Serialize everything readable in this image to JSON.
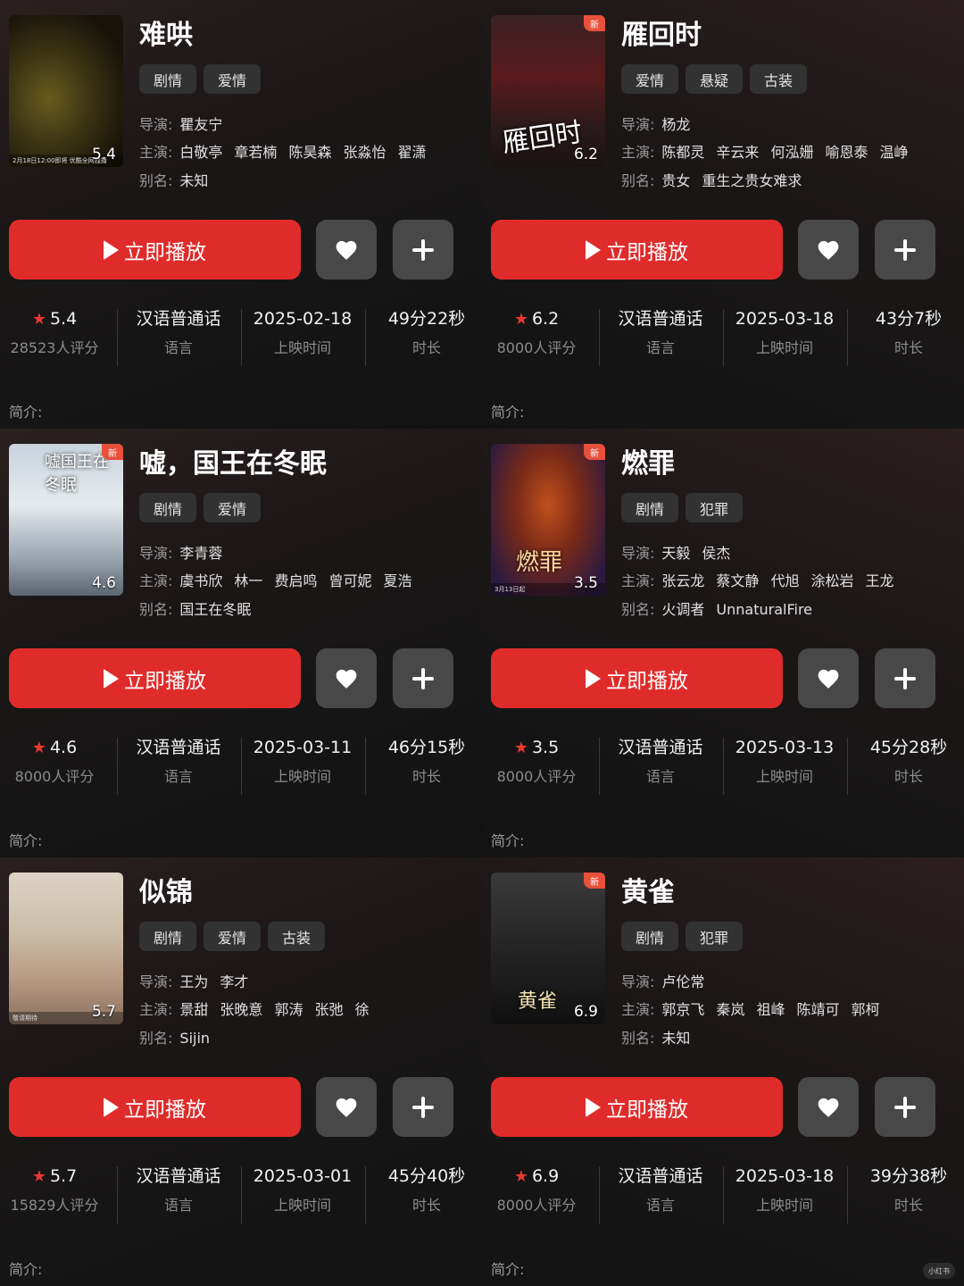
{
  "labels": {
    "director": "导演:",
    "cast": "主演:",
    "alias": "别名:",
    "play": "立即播放",
    "intro": "简介:",
    "language_label": "语言",
    "release_label": "上映时间",
    "duration_label": "时长",
    "new_badge": "新"
  },
  "watermark": "小红书",
  "colors": {
    "accent": "#e02b2b",
    "star": "#e8392f",
    "icon_button": "#484848"
  },
  "shows": [
    {
      "title": "难哄",
      "poster_score": "5.4",
      "poster_caption": "2月18日12:00即将 优酷全网独播",
      "has_new_badge": false,
      "tags": [
        "剧情",
        "爱情"
      ],
      "directors": [
        "瞿友宁"
      ],
      "cast": [
        "白敬亭",
        "章若楠",
        "陈昊森",
        "张淼怡",
        "翟潇"
      ],
      "alias": [
        "未知"
      ],
      "rating": "5.4",
      "rating_count": "28523人评分",
      "language": "汉语普通话",
      "release": "2025-02-18",
      "duration": "49分22秒"
    },
    {
      "title": "雁回时",
      "poster_score": "6.2",
      "poster_title": "雁回时",
      "has_new_badge": true,
      "tags": [
        "爱情",
        "悬疑",
        "古装"
      ],
      "directors": [
        "杨龙"
      ],
      "cast": [
        "陈都灵",
        "辛云来",
        "何泓姗",
        "喻恩泰",
        "温峥"
      ],
      "alias": [
        "贵女",
        "重生之贵女难求"
      ],
      "rating": "6.2",
      "rating_count": "8000人评分",
      "language": "汉语普通话",
      "release": "2025-03-18",
      "duration": "43分7秒"
    },
    {
      "title": "嘘，国王在冬眠",
      "poster_score": "4.6",
      "poster_title": "嘘国王在冬眠",
      "has_new_badge": true,
      "tags": [
        "剧情",
        "爱情"
      ],
      "directors": [
        "李青蓉"
      ],
      "cast": [
        "虞书欣",
        "林一",
        "费启鸣",
        "曾可妮",
        "夏浩"
      ],
      "alias": [
        "国王在冬眠"
      ],
      "rating": "4.6",
      "rating_count": "8000人评分",
      "language": "汉语普通话",
      "release": "2025-03-11",
      "duration": "46分15秒"
    },
    {
      "title": "燃罪",
      "poster_score": "3.5",
      "poster_title": "燃罪",
      "poster_caption": "3月13日起",
      "has_new_badge": true,
      "tags": [
        "剧情",
        "犯罪"
      ],
      "directors": [
        "天毅",
        "侯杰"
      ],
      "cast": [
        "张云龙",
        "蔡文静",
        "代旭",
        "涂松岩",
        "王龙"
      ],
      "alias": [
        "火调者",
        "UnnaturalFire"
      ],
      "rating": "3.5",
      "rating_count": "8000人评分",
      "language": "汉语普通话",
      "release": "2025-03-13",
      "duration": "45分28秒"
    },
    {
      "title": "似锦",
      "poster_score": "5.7",
      "poster_caption": "敬请期待",
      "has_new_badge": false,
      "tags": [
        "剧情",
        "爱情",
        "古装"
      ],
      "directors": [
        "王为",
        "李才"
      ],
      "cast": [
        "景甜",
        "张晚意",
        "郭涛",
        "张弛",
        "徐"
      ],
      "alias": [
        "Sijin"
      ],
      "rating": "5.7",
      "rating_count": "15829人评分",
      "language": "汉语普通话",
      "release": "2025-03-01",
      "duration": "45分40秒"
    },
    {
      "title": "黄雀",
      "poster_score": "6.9",
      "poster_title": "黄雀",
      "has_new_badge": true,
      "tags": [
        "剧情",
        "犯罪"
      ],
      "directors": [
        "卢伦常"
      ],
      "cast": [
        "郭京飞",
        "秦岚",
        "祖峰",
        "陈靖可",
        "郭柯"
      ],
      "alias": [
        "未知"
      ],
      "rating": "6.9",
      "rating_count": "8000人评分",
      "language": "汉语普通话",
      "release": "2025-03-18",
      "duration": "39分38秒"
    }
  ]
}
